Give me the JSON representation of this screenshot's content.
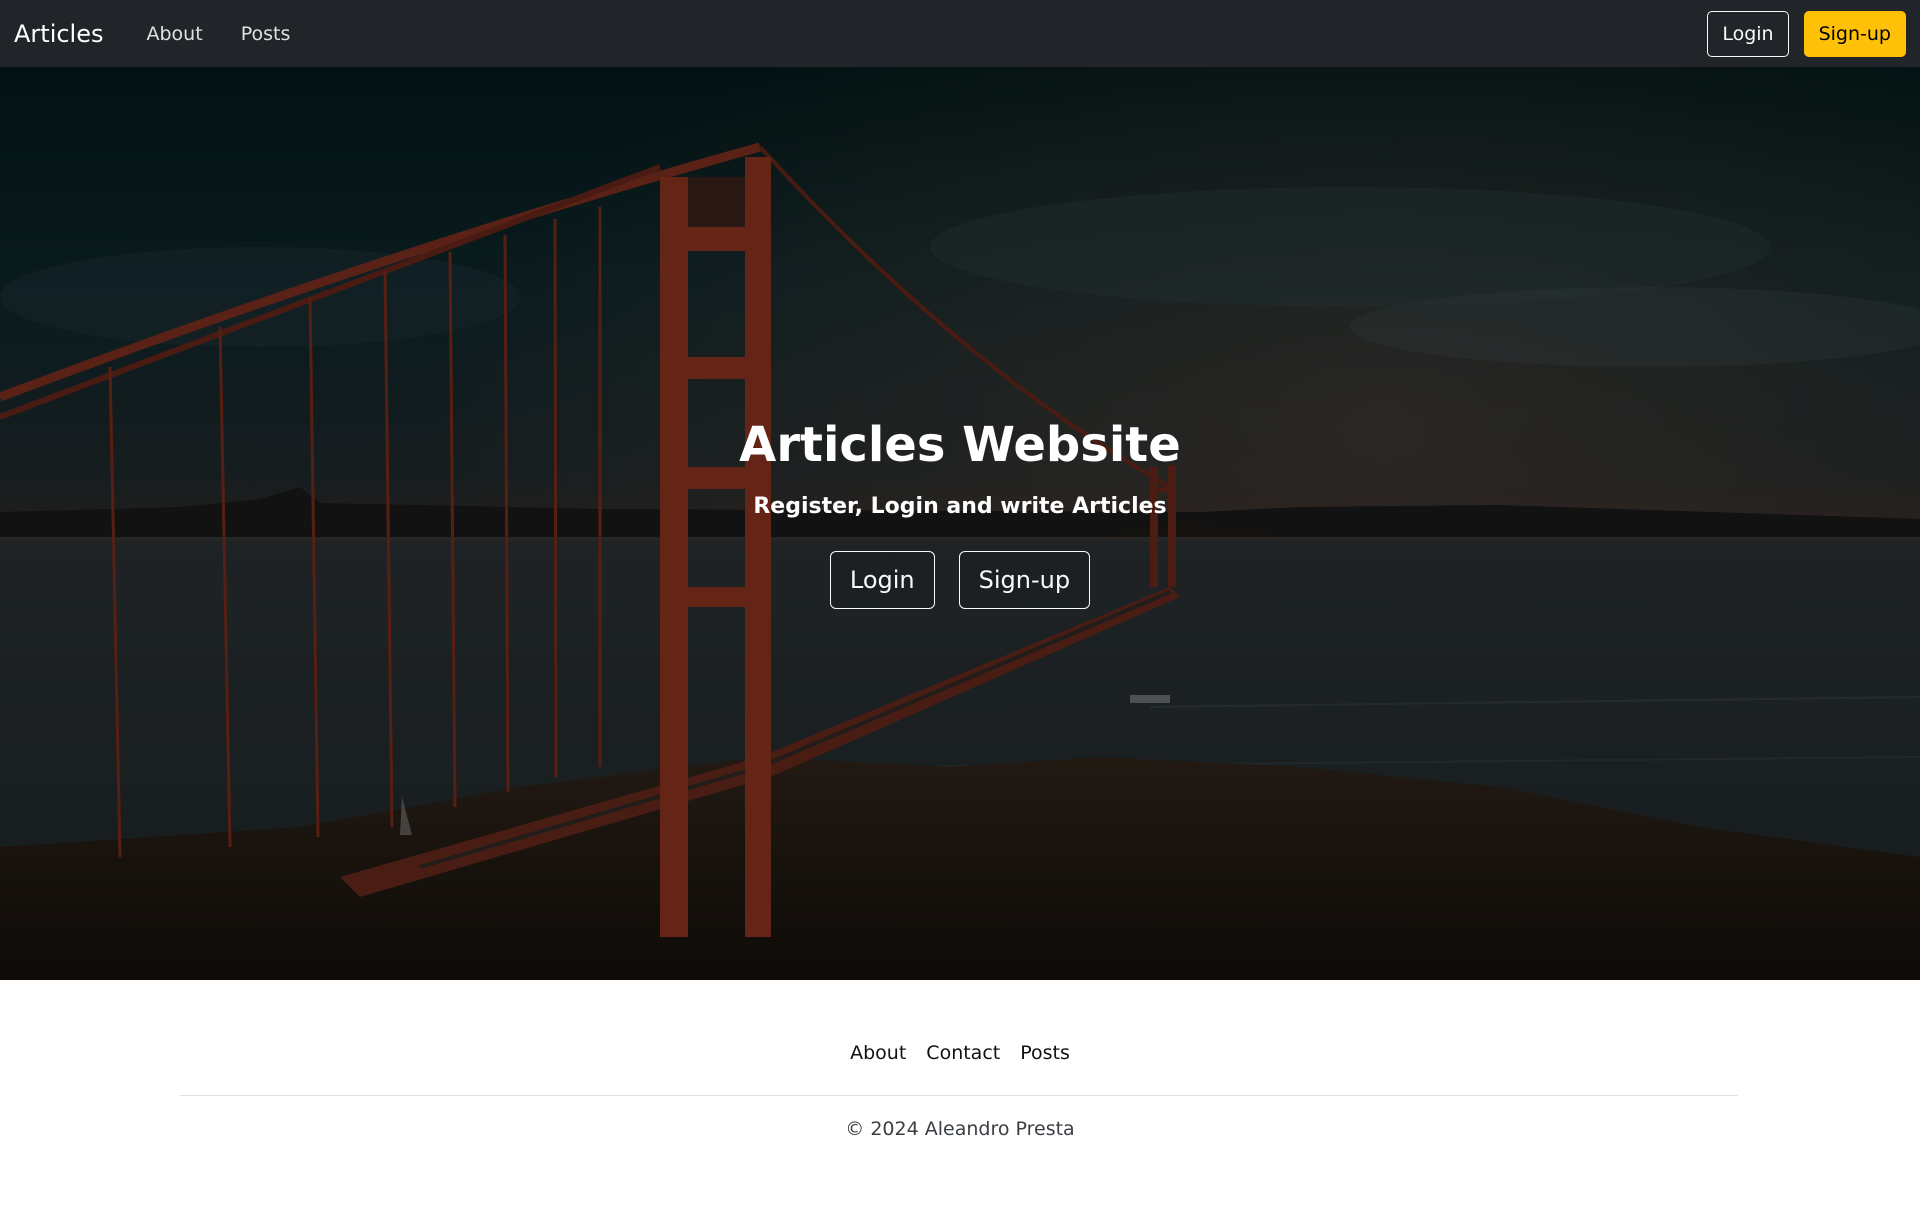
{
  "navbar": {
    "brand": "Articles",
    "links": [
      "About",
      "Posts"
    ],
    "login_label": "Login",
    "signup_label": "Sign-up"
  },
  "hero": {
    "title": "Articles Website",
    "subtitle": "Register, Login and write Articles",
    "login_label": "Login",
    "signup_label": "Sign-up"
  },
  "footer": {
    "links": [
      "About",
      "Contact",
      "Posts"
    ],
    "copyright": "© 2024 Aleandro Presta"
  },
  "colors": {
    "navbar_bg": "#212529",
    "accent": "#ffc107",
    "footer_bg": "#ffffff"
  }
}
